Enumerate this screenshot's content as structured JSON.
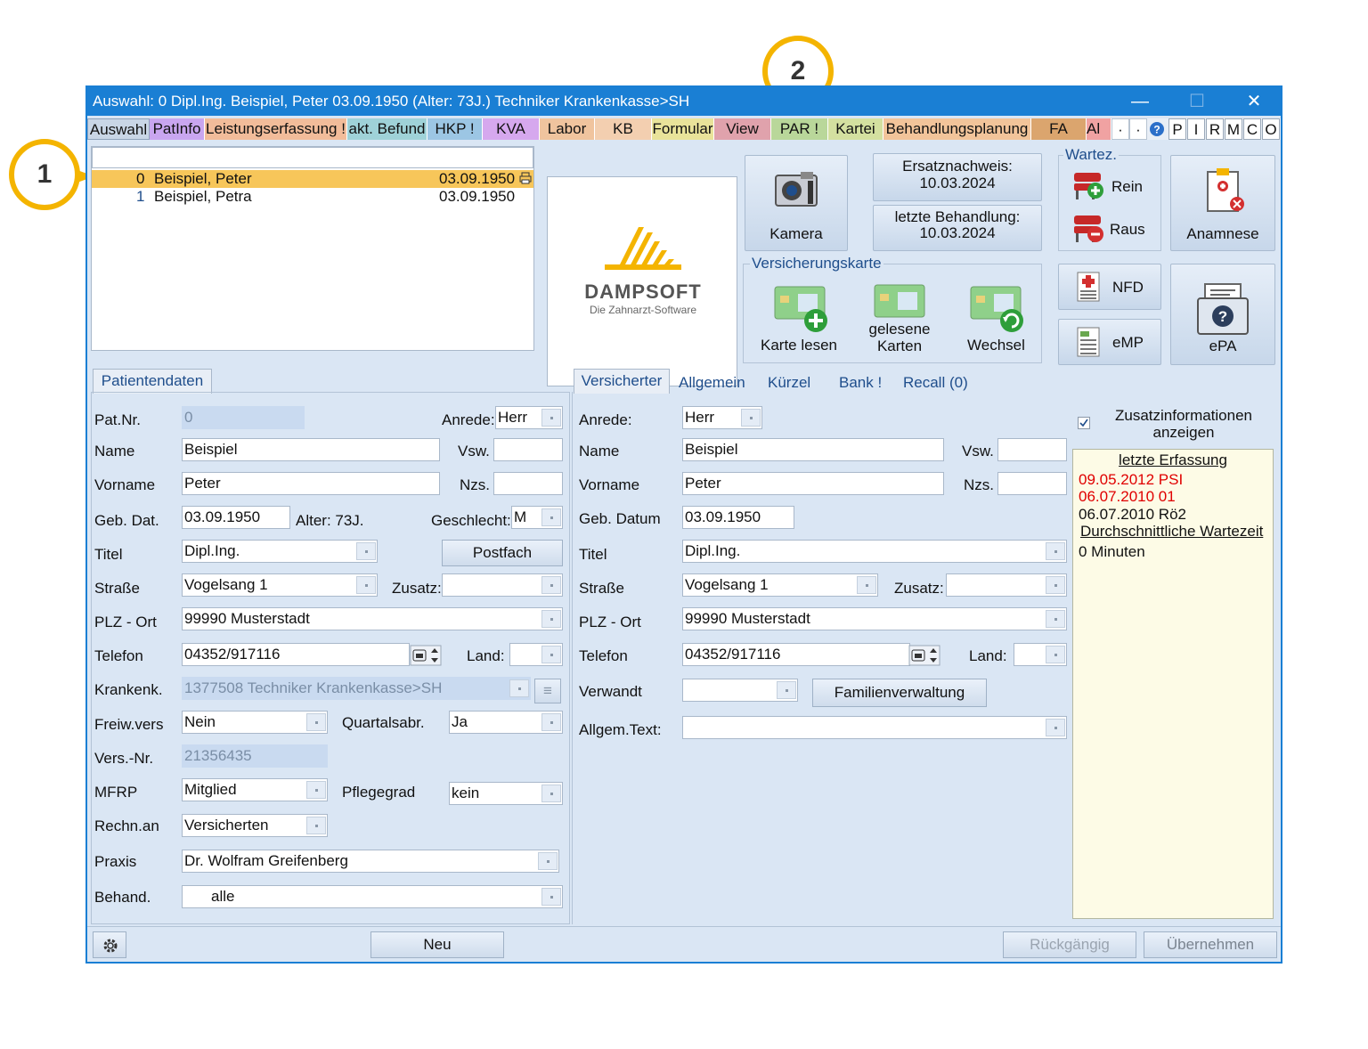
{
  "callouts": [
    "1",
    "2"
  ],
  "window": {
    "title": "Auswahl: 0  Dipl.Ing. Beispiel, Peter  03.09.1950 (Alter: 73J.)  Techniker Krankenkasse>SH",
    "min": "—",
    "max": "☐",
    "close": "✕"
  },
  "tabs": [
    "Auswahl",
    "PatInfo",
    "Leistungserfassung !",
    "akt. Befund",
    "HKP !",
    "KVA",
    "Labor",
    "KB",
    "Formular",
    "View",
    "PAR !",
    "Kartei",
    "Behandlungsplanung",
    "FA",
    "Al"
  ],
  "quick_buttons": [
    "P",
    "I",
    "R",
    "M",
    "C",
    "O"
  ],
  "patient_list": {
    "search_value": "",
    "rows": [
      {
        "num": "0",
        "name": "Beispiel, Peter",
        "date": "03.09.1950"
      },
      {
        "num": "1",
        "name": "Beispiel, Petra",
        "date": "03.09.1950"
      }
    ]
  },
  "logo": {
    "brand": "DAMPSOFT",
    "tagline": "Die Zahnarzt-Software"
  },
  "toolbar": {
    "kamera": "Kamera",
    "ersatznachweis_label": "Ersatznachweis:",
    "ersatznachweis_date": "10.03.2024",
    "letzte_behandlung_label": "letzte Behandlung:",
    "letzte_behandlung_date": "10.03.2024",
    "wartez_title": "Wartez.",
    "rein": "Rein",
    "raus": "Raus",
    "anamnese": "Anamnese",
    "vk_title": "Versicherungskarte",
    "karte_lesen": "Karte lesen",
    "gelesene_1": "gelesene",
    "gelesene_2": "Karten",
    "wechsel": "Wechsel",
    "nfd": "NFD",
    "emp": "eMP",
    "epa": "ePA"
  },
  "left": {
    "tab": "Patientendaten",
    "labels": {
      "patnr": "Pat.Nr.",
      "anrede": "Anrede:",
      "name": "Name",
      "vsw": "Vsw.",
      "vorname": "Vorname",
      "nzs": "Nzs.",
      "gebdat": "Geb. Dat.",
      "alter": "Alter: 73J.",
      "geschlecht": "Geschlecht:",
      "titel": "Titel",
      "strasse": "Straße",
      "zusatz": "Zusatz:",
      "plz": "PLZ - Ort",
      "telefon": "Telefon",
      "land": "Land:",
      "krankenk": "Krankenk.",
      "freiwvers": "Freiw.vers",
      "quartalsabr": "Quartalsabr.",
      "versnr": "Vers.-Nr.",
      "mfrp": "MFRP",
      "pflegegrad": "Pflegegrad",
      "rechnan": "Rechn.an",
      "praxis": "Praxis",
      "behand": "Behand."
    },
    "values": {
      "patnr": "0",
      "anrede": "Herr",
      "name": "Beispiel",
      "vsw": "",
      "vorname": "Peter",
      "nzs": "",
      "gebdat": "03.09.1950",
      "geschlecht": "M",
      "titel": "Dipl.Ing.",
      "strasse": "Vogelsang 1",
      "zusatz": "",
      "plz": "99990 Musterstadt",
      "telefon": "04352/917116",
      "land": "",
      "krankenk": "1377508 Techniker Krankenkasse>SH",
      "freiwvers": "Nein",
      "quartalsabr": "Ja",
      "versnr": "21356435",
      "mfrp": "Mitglied",
      "pflegegrad": "kein",
      "rechnan": "Versicherten",
      "praxis": "Dr. Wolfram Greifenberg",
      "behand": "alle"
    },
    "postfach": "Postfach"
  },
  "right": {
    "tabs": [
      "Versicherter",
      "Allgemein",
      "Kürzel",
      "Bank !",
      "Recall (0)"
    ],
    "labels": {
      "anrede": "Anrede:",
      "name": "Name",
      "vsw": "Vsw.",
      "vorname": "Vorname",
      "nzs": "Nzs.",
      "gebdatum": "Geb. Datum",
      "titel": "Titel",
      "strasse": "Straße",
      "zusatz": "Zusatz:",
      "plz": "PLZ - Ort",
      "telefon": "Telefon",
      "land": "Land:",
      "verwandt": "Verwandt",
      "allgemtext": "Allgem.Text:"
    },
    "values": {
      "anrede": "Herr",
      "name": "Beispiel",
      "vsw": "",
      "vorname": "Peter",
      "nzs": "",
      "gebdatum": "03.09.1950",
      "titel": "Dipl.Ing.",
      "strasse": "Vogelsang 1",
      "zusatz": "",
      "plz": "99990 Musterstadt",
      "telefon": "04352/917116",
      "land": "",
      "verwandt": "",
      "allgemtext": ""
    },
    "familienverwaltung": "Familienverwaltung"
  },
  "info": {
    "checkbox_checked": true,
    "zusatz_1": "Zusatzinformationen",
    "zusatz_2": "anzeigen",
    "letzte_erfassung": "letzte Erfassung",
    "entries": [
      {
        "text": "09.05.2012 PSI",
        "color": "#e00000"
      },
      {
        "text": "06.07.2010 01",
        "color": "#e00000"
      },
      {
        "text": "06.07.2010 Rö2",
        "color": "#111111"
      }
    ],
    "wartezeit_title": "Durchschnittliche Wartezeit",
    "wartezeit_value": "0 Minuten"
  },
  "footer": {
    "neu": "Neu",
    "rueckgaengig": "Rückgängig",
    "uebernehmen": "Übernehmen"
  },
  "colors": {
    "titlebar": "#1a7fd4",
    "callout": "#f4b400",
    "selected_row": "#f7c65a",
    "accent_link": "#1f4e8c"
  }
}
